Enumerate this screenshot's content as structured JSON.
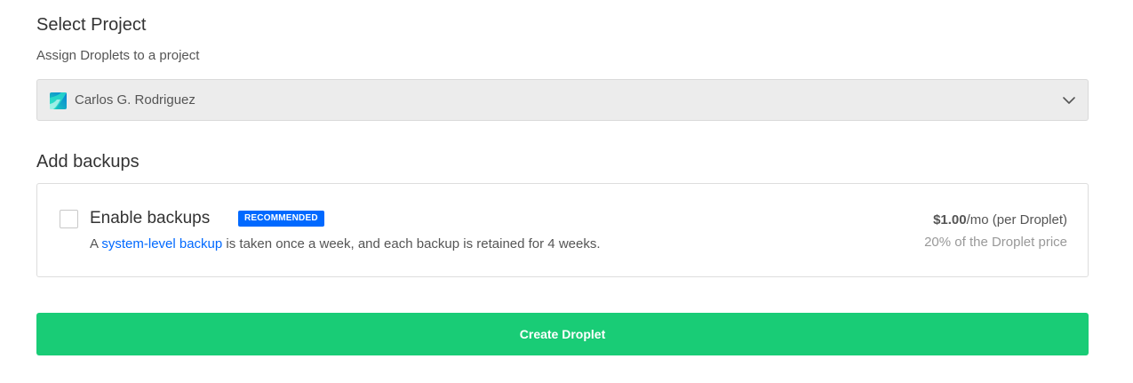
{
  "select_project": {
    "title": "Select Project",
    "subtitle": "Assign Droplets to a project",
    "selected_project": "Carlos G. Rodriguez",
    "project_icon": "project-logo-icon",
    "dropdown_icon": "chevron-down-icon"
  },
  "backups": {
    "title": "Add backups",
    "option_label": "Enable backups",
    "badge": "RECOMMENDED",
    "description_prefix": "A ",
    "description_link": "system-level backup",
    "description_suffix": " is taken once a week, and each backup is retained for 4 weeks.",
    "price_amount": "$1.00",
    "price_unit": "/mo (per Droplet)",
    "price_note": "20% of the Droplet price",
    "checked": false
  },
  "actions": {
    "create_label": "Create Droplet"
  },
  "colors": {
    "accent_blue": "#0069ff",
    "create_green": "#19cc76",
    "select_bg": "#ececec"
  }
}
